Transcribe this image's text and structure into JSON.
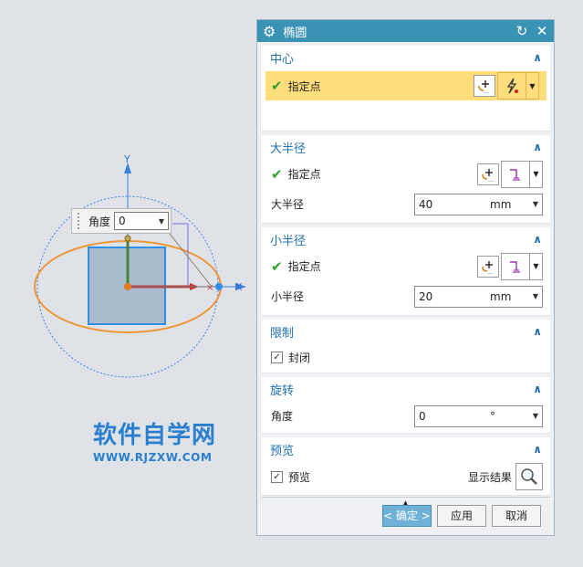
{
  "viewport": {
    "axis_y": "Y",
    "axis_x": "X",
    "angle_popup": {
      "label": "角度",
      "value": "0"
    }
  },
  "watermark": {
    "cn": "软件自学网",
    "en": "WWW.RJZXW.COM"
  },
  "dialog": {
    "title": "椭圆",
    "sections": {
      "center": {
        "title": "中心",
        "point_label": "指定点"
      },
      "major": {
        "title": "大半径",
        "point_label": "指定点",
        "radius_label": "大半径",
        "radius_value": "40",
        "unit": "mm"
      },
      "minor": {
        "title": "小半径",
        "point_label": "指定点",
        "radius_label": "小半径",
        "radius_value": "20",
        "unit": "mm"
      },
      "limit": {
        "title": "限制",
        "closed_label": "封闭",
        "closed_checked": true
      },
      "rotate": {
        "title": "旋转",
        "angle_label": "角度",
        "angle_value": "0",
        "unit": "°"
      },
      "preview": {
        "title": "预览",
        "preview_label": "预览",
        "preview_checked": true,
        "show_result_label": "显示结果"
      }
    },
    "buttons": {
      "ok": "< 确定 >",
      "apply": "应用",
      "cancel": "取消"
    }
  },
  "colors": {
    "titlebar": "#3a92b4",
    "section_title": "#1f6fae",
    "highlight": "#fedd7a",
    "check": "#2ea02e",
    "ellipse": "#f0953a",
    "square": "#a9bccf"
  }
}
